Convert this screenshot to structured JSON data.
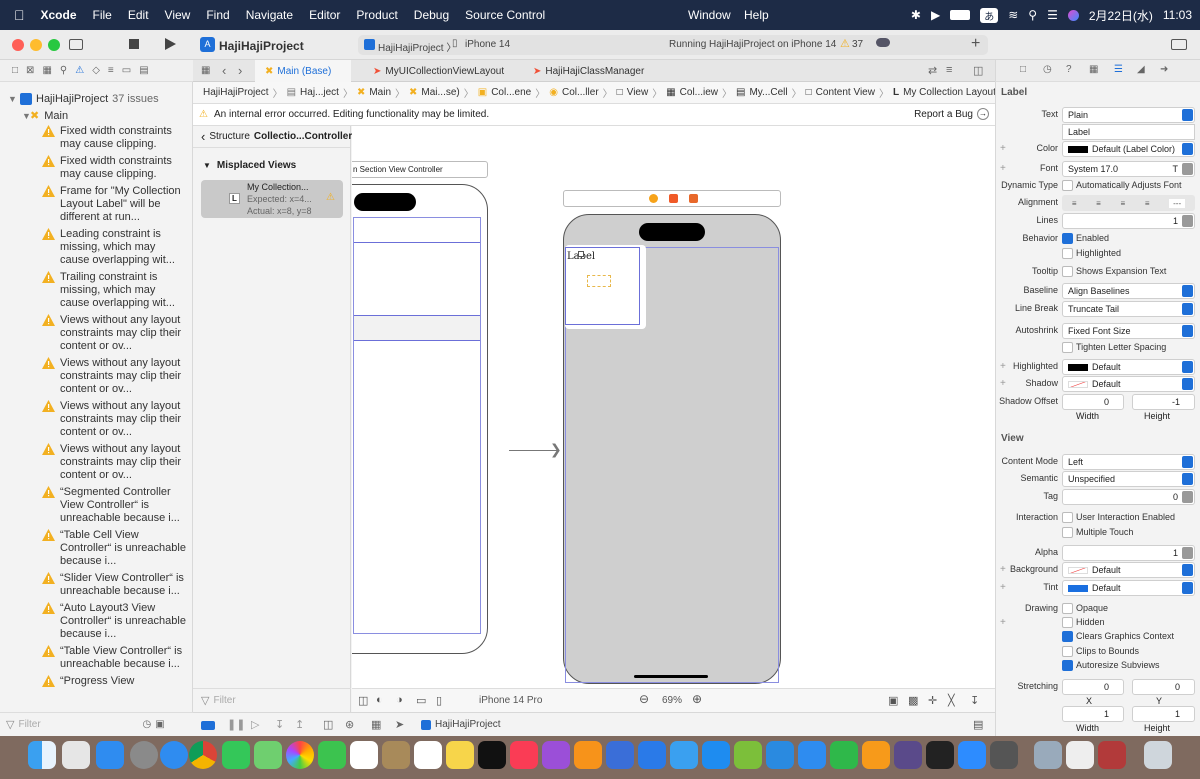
{
  "menubar": {
    "app": "Xcode",
    "items": [
      "File",
      "Edit",
      "View",
      "Find",
      "Navigate",
      "Editor",
      "Product",
      "Debug",
      "Source Control"
    ],
    "window": "Window",
    "help": "Help",
    "ime": "あ",
    "date": "2月22日(水)",
    "time": "11:03"
  },
  "toolbar": {
    "project": "HajiHajiProject",
    "scheme": "HajiHajiProject 〉",
    "device": "iPhone 14",
    "status": "Running HajiHajiProject on iPhone 14",
    "warnings": "37"
  },
  "tabs": [
    "Main (Base)",
    "MyUICollectionViewLayout",
    "HajiHajiClassManager"
  ],
  "jumpbar": [
    "HajiHajiProject",
    "Haj...ject",
    "Main",
    "Mai...se)",
    "Col...ene",
    "Col...ller",
    "View",
    "Col...iew",
    "My...Cell",
    "Content View",
    "My Collection Layout Label"
  ],
  "jumpbar_letter": "L",
  "error": {
    "message": "An internal error occurred. Editing functionality may be limited.",
    "report": "Report a Bug"
  },
  "navigator": {
    "project": "HajiHajiProject",
    "issues_count": "37 issues",
    "group": "Main",
    "issues": [
      "Fixed width constraints may cause clipping.",
      "Fixed width constraints may cause clipping.",
      "Frame for \"My Collection Layout Label\" will be different at run...",
      "Leading constraint is missing, which may cause overlapping wit...",
      "Trailing constraint is missing, which may cause overlapping wit...",
      "Views without any layout constraints may clip their content or ov...",
      "Views without any layout constraints may clip their content or ov...",
      "Views without any layout constraints may clip their content or ov...",
      "Views without any layout constraints may clip their content or ov...",
      "“Segmented Controller View Controller“ is unreachable because i...",
      "“Table Cell View Controller“ is unreachable because i...",
      "“Slider View Controller“ is unreachable because i...",
      "“Auto Layout3 View Controller“ is unreachable because i...",
      "“Table View Controller“ is unreachable because i...",
      "“Progress View"
    ],
    "filter_placeholder": "Filter"
  },
  "outline": {
    "structure_label": "Structure",
    "structure_title": "Collectio...Controller",
    "section": "Misplaced Views",
    "item_name": "My Collection...",
    "item_badge": "L",
    "expected": "Expected: x=4...",
    "actual": "Actual: x=8, y=8",
    "filter_placeholder": "Filter"
  },
  "canvas": {
    "left_scene_title": "n Section View Controller",
    "label_text": "Label",
    "device_label": "iPhone 14 Pro",
    "zoom": "69%"
  },
  "debug": {
    "target": "HajiHajiProject"
  },
  "inspector": {
    "label_section": "Label",
    "view_section": "View",
    "text_label": "Text",
    "text_value": "Plain",
    "label_value": "Label",
    "color_label": "Color",
    "color_value": "Default (Label Color)",
    "font_label": "Font",
    "font_value": "System 17.0",
    "dyntype_label": "Dynamic Type",
    "dyntype_value": "Automatically Adjusts Font",
    "alignment_label": "Alignment",
    "alignment_dash": "---",
    "lines_label": "Lines",
    "lines_value": "1",
    "behavior_label": "Behavior",
    "enabled": "Enabled",
    "highlighted": "Highlighted",
    "tooltip_label": "Tooltip",
    "tooltip_value": "Shows Expansion Text",
    "baseline_label": "Baseline",
    "baseline_value": "Align Baselines",
    "linebreak_label": "Line Break",
    "linebreak_value": "Truncate Tail",
    "autoshrink_label": "Autoshrink",
    "autoshrink_value": "Fixed Font Size",
    "tighten": "Tighten Letter Spacing",
    "highlighted_label": "Highlighted",
    "highlighted_value": "Default",
    "shadow_label": "Shadow",
    "shadow_value": "Default",
    "shadowoffset_label": "Shadow Offset",
    "shadow_w": "0",
    "shadow_h": "-1",
    "width": "Width",
    "height": "Height",
    "contentmode_label": "Content Mode",
    "contentmode_value": "Left",
    "semantic_label": "Semantic",
    "semantic_value": "Unspecified",
    "tag_label": "Tag",
    "tag_value": "0",
    "interaction_label": "Interaction",
    "user_interaction": "User Interaction Enabled",
    "multiple_touch": "Multiple Touch",
    "alpha_label": "Alpha",
    "alpha_value": "1",
    "background_label": "Background",
    "background_value": "Default",
    "tint_label": "Tint",
    "tint_value": "Default",
    "drawing_label": "Drawing",
    "opaque": "Opaque",
    "hidden": "Hidden",
    "clears": "Clears Graphics Context",
    "clips": "Clips to Bounds",
    "autoresize": "Autoresize Subviews",
    "stretching_label": "Stretching",
    "stretch_x": "0",
    "stretch_y": "0",
    "x": "X",
    "y": "Y",
    "stretch_w": "1",
    "stretch_h": "1"
  },
  "colors": {
    "accent": "#1e6fd8",
    "warning": "#f2b021",
    "tint": "#1a6fe0"
  }
}
